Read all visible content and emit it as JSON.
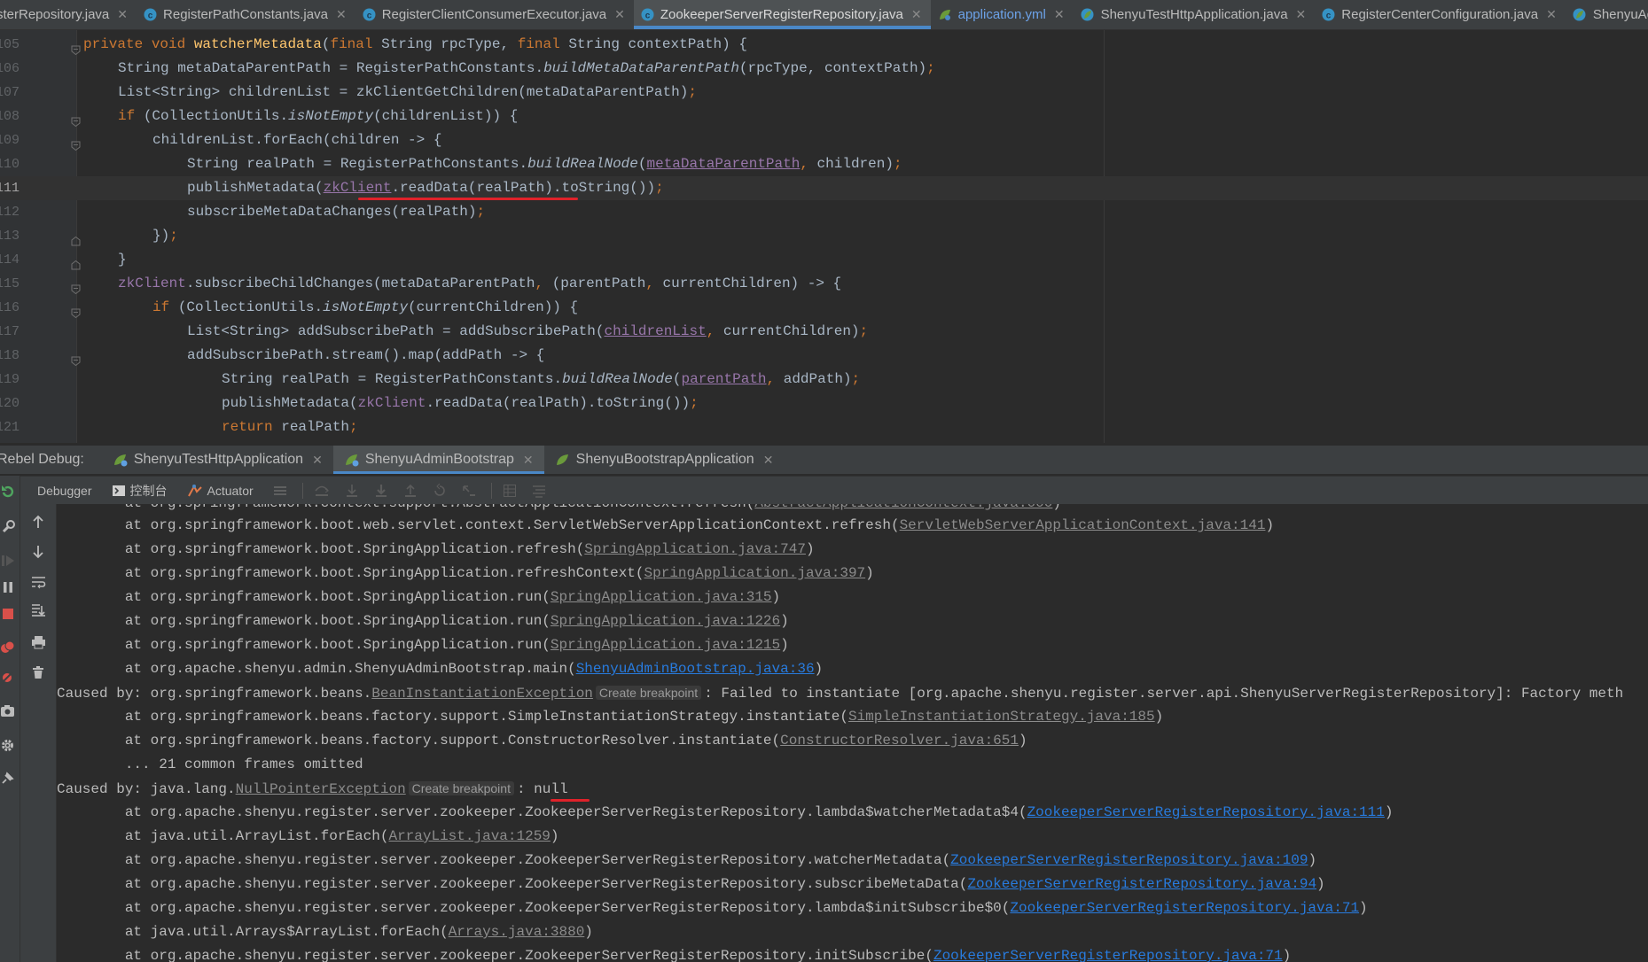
{
  "editor_tabs": [
    {
      "label": "sterRepository.java",
      "icon": "class-icon",
      "active": false
    },
    {
      "label": "RegisterPathConstants.java",
      "icon": "class-icon",
      "active": false
    },
    {
      "label": "RegisterClientConsumerExecutor.java",
      "icon": "class-icon",
      "active": false
    },
    {
      "label": "ZookeeperServerRegisterRepository.java",
      "icon": "class-icon",
      "active": true
    },
    {
      "label": "application.yml",
      "icon": "spring-config-icon",
      "active": false
    },
    {
      "label": "ShenyuTestHttpApplication.java",
      "icon": "spring-class-icon",
      "active": false
    },
    {
      "label": "RegisterCenterConfiguration.java",
      "icon": "class-icon",
      "active": false
    },
    {
      "label": "ShenyuAdminBootstrap.java",
      "icon": "spring-class-icon",
      "active": false
    }
  ],
  "editor": {
    "current_line": "111",
    "line_numbers": [
      "105",
      "106",
      "107",
      "108",
      "109",
      "110",
      "111",
      "112",
      "113",
      "114",
      "115",
      "116",
      "117",
      "118",
      "119",
      "120",
      "121"
    ],
    "code_lines": [
      "    private void watcherMetadata(final String rpcType, final String contextPath) {",
      "        String metaDataParentPath = RegisterPathConstants.buildMetaDataParentPath(rpcType, contextPath);",
      "        List<String> childrenList = zkClientGetChildren(metaDataParentPath);",
      "        if (CollectionUtils.isNotEmpty(childrenList)) {",
      "            childrenList.forEach(children -> {",
      "                String realPath = RegisterPathConstants.buildRealNode(metaDataParentPath, children);",
      "                publishMetadata(zkClient.readData(realPath).toString());",
      "                subscribeMetaDataChanges(realPath);",
      "            });",
      "        }",
      "        zkClient.subscribeChildChanges(metaDataParentPath, (parentPath, currentChildren) -> {",
      "            if (CollectionUtils.isNotEmpty(currentChildren)) {",
      "                List<String> addSubscribePath = addSubscribePath(childrenList, currentChildren);",
      "                addSubscribePath.stream().map(addPath -> {",
      "                    String realPath = RegisterPathConstants.buildRealNode(parentPath, addPath);",
      "                    publishMetadata(zkClient.readData(realPath).toString());",
      "                    return realPath;"
    ]
  },
  "rebel_debug": {
    "title": "Rebel Debug:",
    "tabs": [
      {
        "label": "ShenyuTestHttpApplication",
        "active": false
      },
      {
        "label": "ShenyuAdminBootstrap",
        "active": true
      },
      {
        "label": "ShenyuBootstrapApplication",
        "active": false
      }
    ]
  },
  "debug_toolbar": {
    "debugger_label": "Debugger",
    "console_label": "控制台",
    "actuator_label": "Actuator"
  },
  "console": {
    "lines": [
      {
        "pre": "        at org.springframework.boot.web.servlet.context.ServletWebServerApplicationContext.refresh(",
        "link": "ServletWebServerApplicationContext.java:141",
        "post": ")"
      },
      {
        "pre": "        at org.springframework.boot.SpringApplication.refresh(",
        "link": "SpringApplication.java:747",
        "post": ")"
      },
      {
        "pre": "        at org.springframework.boot.SpringApplication.refreshContext(",
        "link": "SpringApplication.java:397",
        "post": ")"
      },
      {
        "pre": "        at org.springframework.boot.SpringApplication.run(",
        "link": "SpringApplication.java:315",
        "post": ")"
      },
      {
        "pre": "        at org.springframework.boot.SpringApplication.run(",
        "link": "SpringApplication.java:1226",
        "post": ")"
      },
      {
        "pre": "        at org.springframework.boot.SpringApplication.run(",
        "link": "SpringApplication.java:1215",
        "post": ")"
      },
      {
        "pre": "        at org.apache.shenyu.admin.ShenyuAdminBootstrap.main(",
        "link_blue": "ShenyuAdminBootstrap.java:36",
        "post": ")"
      },
      {
        "pre": "Caused by: org.springframework.beans.",
        "exc": "BeanInstantiationException",
        "bp": "Create breakpoint",
        "post": ": Failed to instantiate [org.apache.shenyu.register.server.api.ShenyuServerRegisterRepository]: Factory meth"
      },
      {
        "pre": "        at org.springframework.beans.factory.support.SimpleInstantiationStrategy.instantiate(",
        "link": "SimpleInstantiationStrategy.java:185",
        "post": ")"
      },
      {
        "pre": "        at org.springframework.beans.factory.support.ConstructorResolver.instantiate(",
        "link": "ConstructorResolver.java:651",
        "post": ")"
      },
      {
        "pre": "        ... 21 common frames omitted"
      },
      {
        "pre": "Caused by: java.lang.",
        "exc": "NullPointerException",
        "bp": "Create breakpoint",
        "post": ": null"
      },
      {
        "pre": "        at org.apache.shenyu.register.server.zookeeper.ZookeeperServerRegisterRepository.lambda$watcherMetadata$4(",
        "link_blue": "ZookeeperServerRegisterRepository.java:111",
        "post": ")"
      },
      {
        "pre": "        at java.util.ArrayList.forEach(",
        "link": "ArrayList.java:1259",
        "post": ")"
      },
      {
        "pre": "        at org.apache.shenyu.register.server.zookeeper.ZookeeperServerRegisterRepository.watcherMetadata(",
        "link_blue": "ZookeeperServerRegisterRepository.java:109",
        "post": ")"
      },
      {
        "pre": "        at org.apache.shenyu.register.server.zookeeper.ZookeeperServerRegisterRepository.subscribeMetaData(",
        "link_blue": "ZookeeperServerRegisterRepository.java:94",
        "post": ")"
      },
      {
        "pre": "        at org.apache.shenyu.register.server.zookeeper.ZookeeperServerRegisterRepository.lambda$initSubscribe$0(",
        "link_blue": "ZookeeperServerRegisterRepository.java:71",
        "post": ")"
      },
      {
        "pre": "        at java.util.Arrays$ArrayList.forEach(",
        "link": "Arrays.java:3880",
        "post": ")"
      },
      {
        "pre": "        at org.apache.shenyu.register.server.zookeeper.ZookeeperServerRegisterRepository.initSubscribe(",
        "link_blue": "ZookeeperServerRegisterRepository.java:71",
        "post": ")"
      }
    ]
  },
  "colors": {
    "accent": "#4a88c7",
    "highlight_mark": "#e0222a",
    "link": "#287bde",
    "keyword": "#cc7832",
    "method": "#ffc66d",
    "field": "#9876aa"
  }
}
